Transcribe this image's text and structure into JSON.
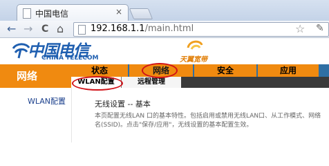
{
  "browser": {
    "tab_title": "中国电信",
    "tab_close": "×",
    "nav": {
      "back": "←",
      "forward": "→",
      "reload": "C",
      "home": "⌂"
    },
    "url": {
      "host": "192.168.1.1",
      "path": "/main.html"
    },
    "star": "☆",
    "wrench": "✎"
  },
  "header": {
    "brand_cn": "中国电信",
    "brand_en": "CHINA TELECOM",
    "tianyi": "天翼宽带"
  },
  "nav": {
    "section_title": "网络",
    "main_tabs": [
      {
        "label": "状态"
      },
      {
        "label": "网络"
      },
      {
        "label": "安全"
      },
      {
        "label": "应用"
      }
    ],
    "sub_tabs": [
      {
        "label": "WLAN配置"
      },
      {
        "label": "远程管理"
      }
    ]
  },
  "sidebar": {
    "items": [
      {
        "label": "WLAN配置"
      }
    ]
  },
  "content": {
    "title": "无线设置 -- 基本",
    "description": "本页配置无线LAN 口的基本特性。包括启用或禁用无线LAN口、从工作模式、网络名(SSID)。点击\"保存/应用\"，无线设置的基本配置生效。"
  },
  "colors": {
    "orange": "#f08a10",
    "nav_blue": "#2f6fa4",
    "brand_blue": "#1f5fb0",
    "highlight_red": "#d11218"
  }
}
